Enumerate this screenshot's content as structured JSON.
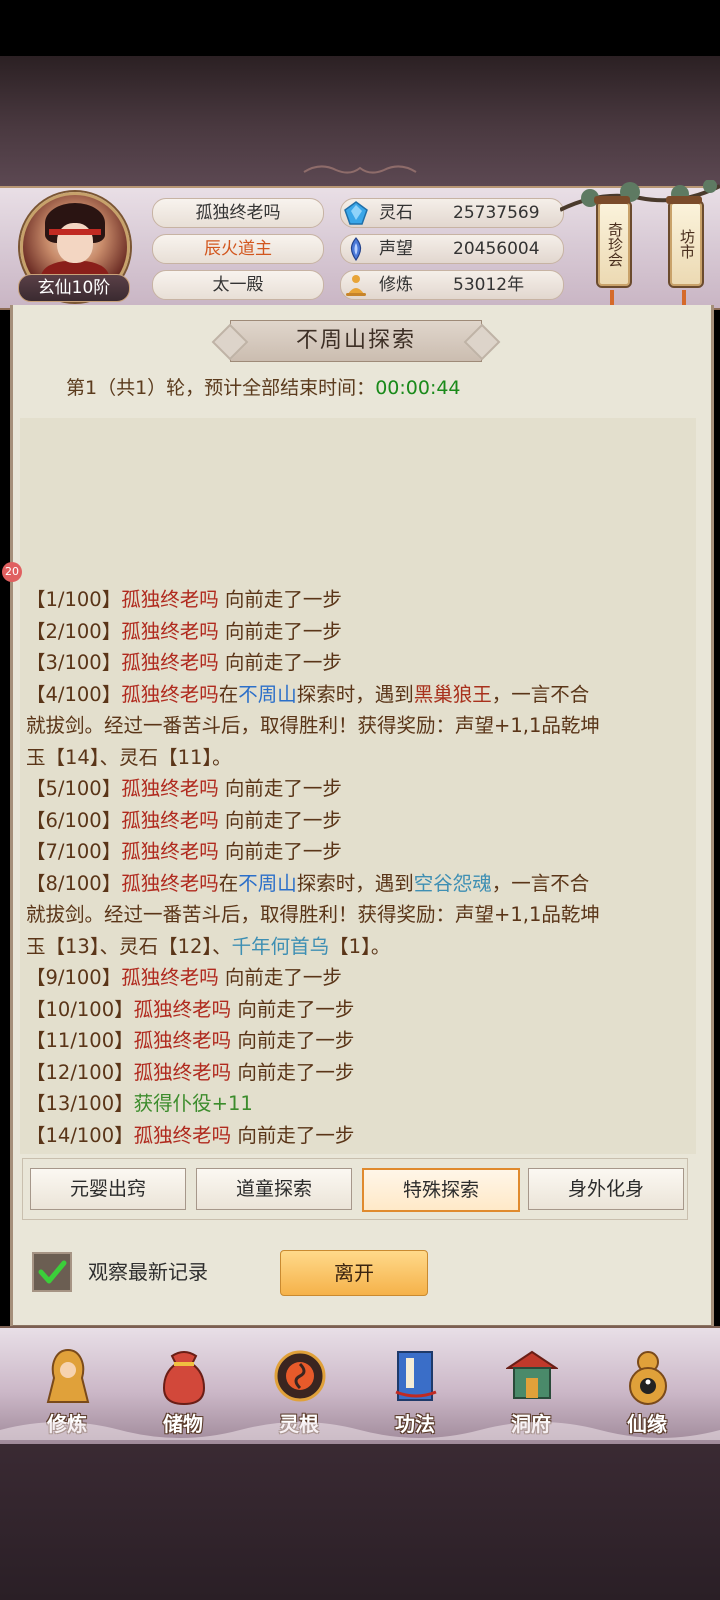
{
  "player": {
    "name": "孤独终老吗",
    "title": "辰火道主",
    "palace": "太一殿",
    "rank": "玄仙10阶"
  },
  "stats": [
    {
      "name": "灵石",
      "value": "25737569",
      "icon": "spirit-stone-icon"
    },
    {
      "name": "声望",
      "value": "20456004",
      "icon": "prestige-icon"
    },
    {
      "name": "修炼",
      "value": "53012年",
      "icon": "meditation-icon"
    }
  ],
  "lanterns": {
    "treasure_fair": "奇珍会",
    "market": "坊市"
  },
  "panel": {
    "title": "不周山探索",
    "round_text": "第1（共1）轮，预计全部结束时间：",
    "round_time": "00:00:44",
    "notification_count": "20"
  },
  "log": [
    [
      {
        "t": "【1/100】",
        "c": ""
      },
      {
        "t": "孤独终老吗",
        "c": "n"
      },
      {
        "t": " 向前走了一步",
        "c": ""
      }
    ],
    [
      {
        "t": "【2/100】",
        "c": ""
      },
      {
        "t": "孤独终老吗",
        "c": "n"
      },
      {
        "t": " 向前走了一步",
        "c": ""
      }
    ],
    [
      {
        "t": "【3/100】",
        "c": ""
      },
      {
        "t": "孤独终老吗",
        "c": "n"
      },
      {
        "t": " 向前走了一步",
        "c": ""
      }
    ],
    [
      {
        "t": "【4/100】",
        "c": ""
      },
      {
        "t": "孤独终老吗",
        "c": "n"
      },
      {
        "t": "在",
        "c": ""
      },
      {
        "t": "不周山",
        "c": "p"
      },
      {
        "t": "探索时，遇到",
        "c": ""
      },
      {
        "t": "黑巢狼王",
        "c": "m"
      },
      {
        "t": "，一言不合",
        "c": ""
      }
    ],
    [
      {
        "t": "就拔剑。经过一番苦斗后，取得胜利！获得奖励：声望+1,1品乾坤",
        "c": ""
      }
    ],
    [
      {
        "t": "玉【14】、灵石【11】。",
        "c": ""
      }
    ],
    [
      {
        "t": "【5/100】",
        "c": ""
      },
      {
        "t": "孤独终老吗",
        "c": "n"
      },
      {
        "t": " 向前走了一步",
        "c": ""
      }
    ],
    [
      {
        "t": "【6/100】",
        "c": ""
      },
      {
        "t": "孤独终老吗",
        "c": "n"
      },
      {
        "t": " 向前走了一步",
        "c": ""
      }
    ],
    [
      {
        "t": "【7/100】",
        "c": ""
      },
      {
        "t": "孤独终老吗",
        "c": "n"
      },
      {
        "t": " 向前走了一步",
        "c": ""
      }
    ],
    [
      {
        "t": "【8/100】",
        "c": ""
      },
      {
        "t": "孤独终老吗",
        "c": "n"
      },
      {
        "t": "在",
        "c": ""
      },
      {
        "t": "不周山",
        "c": "p"
      },
      {
        "t": "探索时，遇到",
        "c": ""
      },
      {
        "t": "空谷怨魂",
        "c": "s"
      },
      {
        "t": "，一言不合",
        "c": ""
      }
    ],
    [
      {
        "t": "就拔剑。经过一番苦斗后，取得胜利！获得奖励：声望+1,1品乾坤",
        "c": ""
      }
    ],
    [
      {
        "t": "玉【13】、灵石【12】、",
        "c": ""
      },
      {
        "t": "千年何首乌",
        "c": "s"
      },
      {
        "t": "【1】。",
        "c": ""
      }
    ],
    [
      {
        "t": "【9/100】",
        "c": ""
      },
      {
        "t": "孤独终老吗",
        "c": "n"
      },
      {
        "t": " 向前走了一步",
        "c": ""
      }
    ],
    [
      {
        "t": "【10/100】",
        "c": ""
      },
      {
        "t": "孤独终老吗",
        "c": "n"
      },
      {
        "t": " 向前走了一步",
        "c": ""
      }
    ],
    [
      {
        "t": "【11/100】",
        "c": ""
      },
      {
        "t": "孤独终老吗",
        "c": "n"
      },
      {
        "t": " 向前走了一步",
        "c": ""
      }
    ],
    [
      {
        "t": "【12/100】",
        "c": ""
      },
      {
        "t": "孤独终老吗",
        "c": "n"
      },
      {
        "t": " 向前走了一步",
        "c": ""
      }
    ],
    [
      {
        "t": "【13/100】",
        "c": ""
      },
      {
        "t": "获得仆役+11",
        "c": "g"
      }
    ],
    [
      {
        "t": "【14/100】",
        "c": ""
      },
      {
        "t": "孤独终老吗",
        "c": "n"
      },
      {
        "t": " 向前走了一步",
        "c": ""
      }
    ]
  ],
  "tabs": [
    {
      "label": "元婴出窍",
      "active": false
    },
    {
      "label": "道童探索",
      "active": false
    },
    {
      "label": "特殊探索",
      "active": true
    },
    {
      "label": "身外化身",
      "active": false
    }
  ],
  "controls": {
    "watch_latest_label": "观察最新记录",
    "watch_latest_checked": true,
    "leave_label": "离开"
  },
  "bottom_nav": [
    {
      "label": "修炼",
      "icon": "cultivation-figure-icon"
    },
    {
      "label": "储物",
      "icon": "storage-bag-icon"
    },
    {
      "label": "灵根",
      "icon": "spirit-root-icon"
    },
    {
      "label": "功法",
      "icon": "technique-book-icon"
    },
    {
      "label": "洞府",
      "icon": "cave-abode-icon"
    },
    {
      "label": "仙缘",
      "icon": "immortal-fate-gourd-icon"
    }
  ],
  "colors": {
    "player_name": "#b02a1e",
    "place": "#2b6fc9",
    "boss": "#a8311c",
    "rare_item": "#3e8fb3",
    "gain": "#3c8c2c",
    "timer": "#1a8a1a",
    "active_tab_border": "#e08a2e"
  }
}
